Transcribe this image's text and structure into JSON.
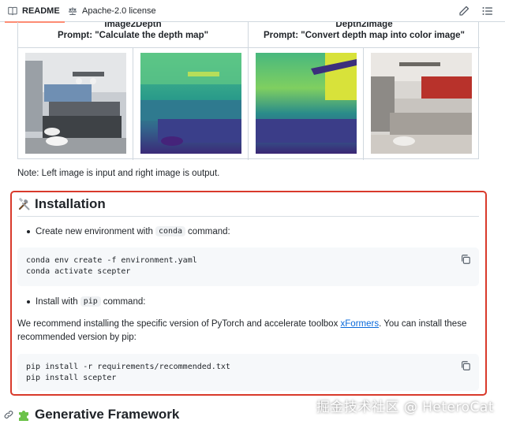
{
  "tabs": {
    "readme": "README",
    "license": "Apache-2.0 license"
  },
  "table": {
    "col1_title": "Image2Depth",
    "col1_prompt": "Prompt: \"Calculate the depth map\"",
    "col2_title": "Depth2Image",
    "col2_prompt": "Prompt: \"Convert depth map into color image\""
  },
  "note": "Note: Left image is input and right image is output.",
  "installation": {
    "heading": "Installation",
    "bullet1_text": "Create new environment with",
    "bullet1_code": "conda",
    "bullet1_suffix": "command:",
    "code1_line1": "conda env create -f environment.yaml",
    "code1_line2": "conda activate scepter",
    "bullet2_text": "Install with",
    "bullet2_code": "pip",
    "bullet2_suffix": "command:",
    "para_before": "We recommend installing the specific version of PyTorch and accelerate toolbox",
    "para_link": "xFormers",
    "para_after": ". You can install these recommended version by pip:",
    "code2_line1": "pip install -r requirements/recommended.txt",
    "code2_line2": "pip install scepter"
  },
  "next_heading": "Generative Framework",
  "watermark": "掘金技术社区 @ HeteroCat",
  "colors": {
    "highlight_border": "#d93a2b",
    "link": "#0969da",
    "tab_underline": "#fd8c73"
  }
}
